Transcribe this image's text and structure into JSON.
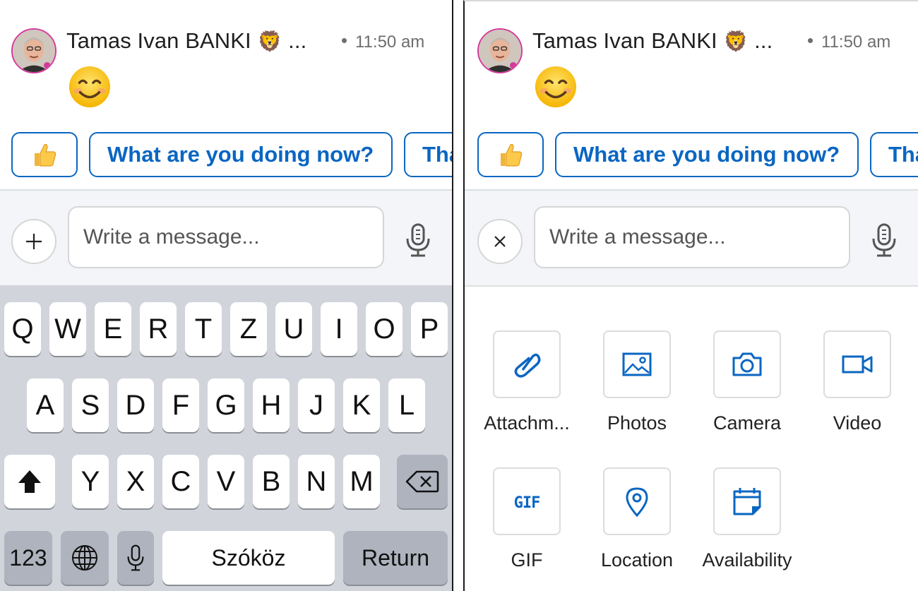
{
  "conversation": {
    "sender_name": "Tamas Ivan BANKI",
    "sender_emoji": "🦁",
    "sender_ellipsis": "...",
    "timestamp": "11:50 am",
    "message_emoji": "smiling-face-icon"
  },
  "quick_replies": {
    "thumb": "thumbs-up-icon",
    "reply_1": "What are you doing now?",
    "reply_2_partial": "Tha"
  },
  "compose": {
    "placeholder": "Write a message..."
  },
  "keyboard": {
    "row1": [
      "Q",
      "W",
      "E",
      "R",
      "T",
      "Z",
      "U",
      "I",
      "O",
      "P"
    ],
    "row2": [
      "A",
      "S",
      "D",
      "F",
      "G",
      "H",
      "J",
      "K",
      "L"
    ],
    "row3": [
      "Y",
      "X",
      "C",
      "V",
      "B",
      "N",
      "M"
    ],
    "numbers_key": "123",
    "space_key": "Szóköz",
    "return_key": "Return"
  },
  "attachments": {
    "items": [
      {
        "label": "Attachm...",
        "icon": "paperclip-icon"
      },
      {
        "label": "Photos",
        "icon": "image-icon"
      },
      {
        "label": "Camera",
        "icon": "camera-icon"
      },
      {
        "label": "Video",
        "icon": "video-camera-icon"
      },
      {
        "label": "GIF",
        "icon": "gif-icon"
      },
      {
        "label": "Location",
        "icon": "map-pin-icon"
      },
      {
        "label": "Availability",
        "icon": "calendar-icon"
      }
    ]
  },
  "colors": {
    "accent": "#0a66c2",
    "keyboard_bg": "#d1d4db",
    "compose_bg": "#f3f5f8"
  }
}
